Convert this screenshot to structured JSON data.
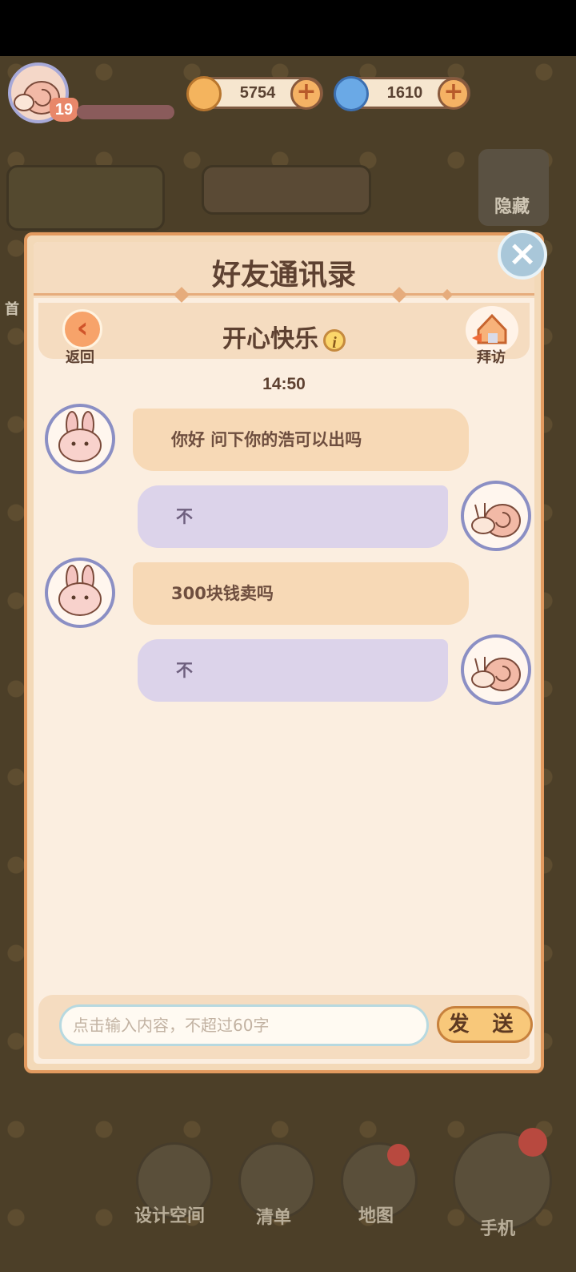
{
  "hud": {
    "level": "19",
    "coins": "5754",
    "gems": "1610",
    "hide_label": "隐藏",
    "home_label_partial": "首"
  },
  "dialog": {
    "title": "好友通讯录",
    "friend_name": "开心快乐",
    "back_label": "返回",
    "visit_label": "拜访",
    "timestamp": "14:50",
    "messages": [
      {
        "sender": "friend",
        "text": "你好  问下你的浩可以出吗"
      },
      {
        "sender": "me",
        "text": "不"
      },
      {
        "sender": "friend",
        "text": "300块钱卖吗"
      },
      {
        "sender": "me",
        "text": "不"
      }
    ],
    "input_placeholder": "点击输入内容，不超过60字",
    "send_label": "发 送"
  },
  "bottom_nav": {
    "design_label": "设计空间",
    "list_label": "清单",
    "map_label": "地图",
    "phone_label": "手机"
  },
  "colors": {
    "dialog_bg": "#fbeee0",
    "dialog_border": "#e29a5f",
    "incoming_bubble": "#f7d9b6",
    "outgoing_bubble": "#dcd3ea",
    "title_text": "#5e4131"
  }
}
